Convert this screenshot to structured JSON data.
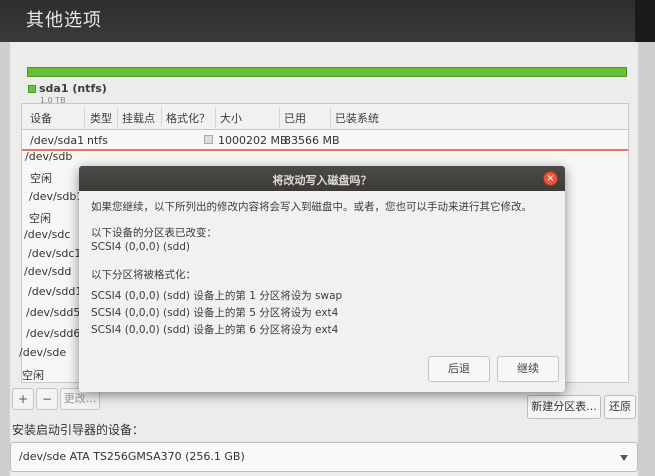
{
  "window": {
    "title": "其他选项"
  },
  "disk": {
    "name": "sda1 (ntfs)",
    "size": "1.0 TB",
    "color": "#6abf3a"
  },
  "table": {
    "headers": [
      "设备",
      "类型",
      "挂载点",
      "格式化？",
      "大小",
      "已用",
      "已装系统"
    ],
    "rows": [
      {
        "device": "/dev/sda1",
        "type": "ntfs",
        "mount": "",
        "size": "1000202 MB",
        "used": "83566 MB",
        "system": ""
      },
      {
        "device": "/dev/sdb"
      },
      {
        "device": "空闲"
      },
      {
        "device": "/dev/sdb1"
      },
      {
        "device": "空闲"
      },
      {
        "device": "/dev/sdc"
      },
      {
        "device": "/dev/sdc1"
      },
      {
        "device": "/dev/sdd"
      },
      {
        "device": "/dev/sdd1"
      },
      {
        "device": "/dev/sdd5"
      },
      {
        "device": "/dev/sdd6"
      },
      {
        "device": "/dev/sde"
      },
      {
        "device": "空闲"
      }
    ]
  },
  "toolbar": {
    "add": "+",
    "remove": "−",
    "change": "更改...",
    "new_table": "新建分区表...",
    "revert": "还原"
  },
  "boot": {
    "label": "安装启动引导器的设备：",
    "value": "/dev/sde   ATA TS256GMSA370 (256.1 GB)"
  },
  "dialog": {
    "title": "将改动写入磁盘吗？",
    "intro": "如果您继续，以下所列出的修改内容将会写入到磁盘中。或者，您也可以手动来进行其它修改。",
    "table_changed_heading": "以下设备的分区表已改变：",
    "table_changed_device": "SCSI4 (0,0,0) (sdd)",
    "format_heading": "以下分区将被格式化：",
    "format_items": [
      "SCSI4 (0,0,0) (sdd) 设备上的第 1 分区将设为 swap",
      "SCSI4 (0,0,0) (sdd) 设备上的第 5 分区将设为 ext4",
      "SCSI4 (0,0,0) (sdd) 设备上的第 6 分区将设为 ext4"
    ],
    "back": "后退",
    "continue": "继续"
  }
}
